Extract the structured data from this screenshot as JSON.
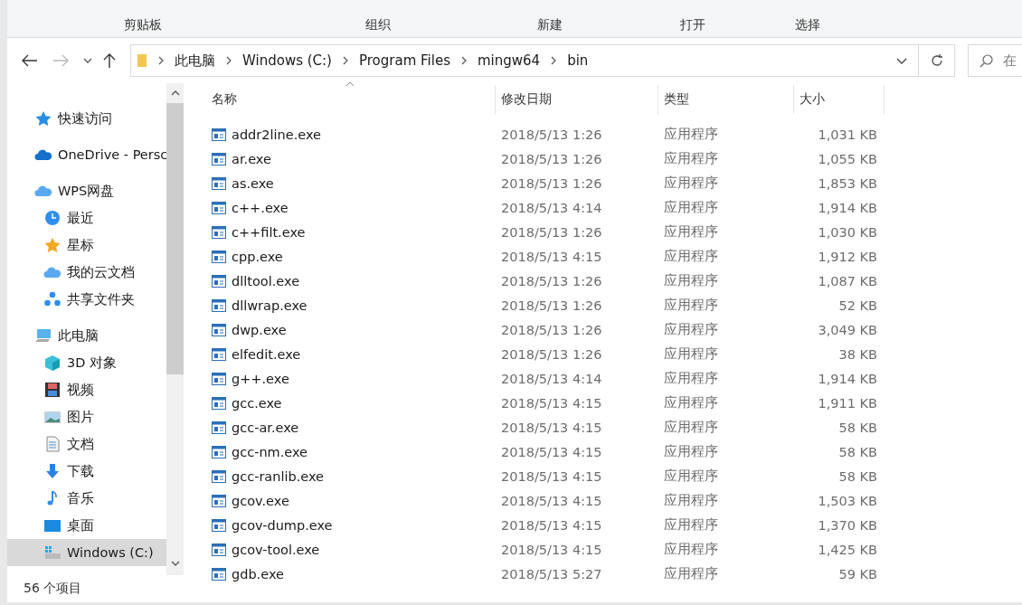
{
  "ribbon": {
    "groups": [
      "剪贴板",
      "组织",
      "新建",
      "打开",
      "选择"
    ]
  },
  "address_bar": {
    "crumbs": [
      "此电脑",
      "Windows (C:)",
      "Program Files",
      "mingw64",
      "bin"
    ],
    "search_placeholder": "在"
  },
  "sidebar": {
    "items": [
      {
        "label": "快速访问",
        "kind": "quick",
        "selected": false
      },
      {
        "label": "OneDrive - Persc",
        "kind": "onedrive",
        "selected": false
      },
      {
        "label": "WPS网盘",
        "kind": "cloud",
        "selected": false,
        "children": [
          {
            "label": "最近",
            "kind": "clock",
            "selected": false
          },
          {
            "label": "星标",
            "kind": "star",
            "selected": false
          },
          {
            "label": "我的云文档",
            "kind": "cloud",
            "selected": false
          },
          {
            "label": "共享文件夹",
            "kind": "share",
            "selected": false
          }
        ]
      },
      {
        "label": "此电脑",
        "kind": "pc",
        "selected": false,
        "children": [
          {
            "label": "3D 对象",
            "kind": "cube",
            "selected": false
          },
          {
            "label": "视频",
            "kind": "film",
            "selected": false
          },
          {
            "label": "图片",
            "kind": "image",
            "selected": false
          },
          {
            "label": "文档",
            "kind": "doc",
            "selected": false
          },
          {
            "label": "下载",
            "kind": "download",
            "selected": false
          },
          {
            "label": "音乐",
            "kind": "music",
            "selected": false
          },
          {
            "label": "桌面",
            "kind": "desktop",
            "selected": false
          },
          {
            "label": "Windows (C:)",
            "kind": "drive",
            "selected": true
          }
        ]
      }
    ]
  },
  "table": {
    "columns": [
      "名称",
      "修改日期",
      "类型",
      "大小"
    ],
    "rows": [
      [
        "addr2line.exe",
        "2018/5/13 1:26",
        "应用程序",
        "1,031 KB"
      ],
      [
        "ar.exe",
        "2018/5/13 1:26",
        "应用程序",
        "1,055 KB"
      ],
      [
        "as.exe",
        "2018/5/13 1:26",
        "应用程序",
        "1,853 KB"
      ],
      [
        "c++.exe",
        "2018/5/13 4:14",
        "应用程序",
        "1,914 KB"
      ],
      [
        "c++filt.exe",
        "2018/5/13 1:26",
        "应用程序",
        "1,030 KB"
      ],
      [
        "cpp.exe",
        "2018/5/13 4:15",
        "应用程序",
        "1,912 KB"
      ],
      [
        "dlltool.exe",
        "2018/5/13 1:26",
        "应用程序",
        "1,087 KB"
      ],
      [
        "dllwrap.exe",
        "2018/5/13 1:26",
        "应用程序",
        "52 KB"
      ],
      [
        "dwp.exe",
        "2018/5/13 1:26",
        "应用程序",
        "3,049 KB"
      ],
      [
        "elfedit.exe",
        "2018/5/13 1:26",
        "应用程序",
        "38 KB"
      ],
      [
        "g++.exe",
        "2018/5/13 4:14",
        "应用程序",
        "1,914 KB"
      ],
      [
        "gcc.exe",
        "2018/5/13 4:15",
        "应用程序",
        "1,911 KB"
      ],
      [
        "gcc-ar.exe",
        "2018/5/13 4:15",
        "应用程序",
        "58 KB"
      ],
      [
        "gcc-nm.exe",
        "2018/5/13 4:15",
        "应用程序",
        "58 KB"
      ],
      [
        "gcc-ranlib.exe",
        "2018/5/13 4:15",
        "应用程序",
        "58 KB"
      ],
      [
        "gcov.exe",
        "2018/5/13 4:15",
        "应用程序",
        "1,503 KB"
      ],
      [
        "gcov-dump.exe",
        "2018/5/13 4:15",
        "应用程序",
        "1,370 KB"
      ],
      [
        "gcov-tool.exe",
        "2018/5/13 4:15",
        "应用程序",
        "1,425 KB"
      ],
      [
        "gdb.exe",
        "2018/5/13 5:27",
        "应用程序",
        "59 KB"
      ]
    ]
  },
  "status_bar": {
    "count": "56 个项目"
  }
}
